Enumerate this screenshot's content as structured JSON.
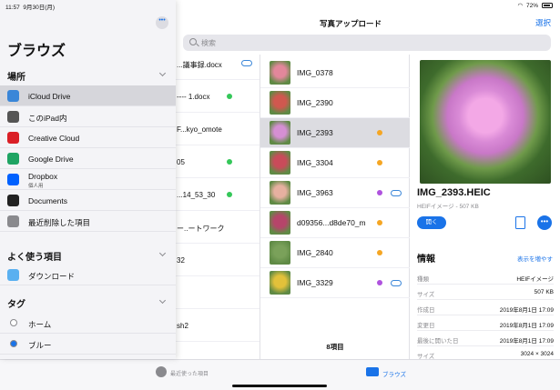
{
  "status_bar": {
    "time": "11:57",
    "date": "9月30日(月)",
    "battery": "72%"
  },
  "nav": {
    "title": "写真アップロード",
    "select": "選択"
  },
  "search": {
    "placeholder": "検索"
  },
  "column1": {
    "rows": [
      {
        "label": "...議事録.docx",
        "indicator": "cloud"
      },
      {
        "label": "---- 1.docx",
        "indicator": "green"
      },
      {
        "label": "F...kyo_omote",
        "indicator": "none"
      },
      {
        "label": "05",
        "indicator": "green"
      },
      {
        "label": "...14_53_30",
        "indicator": "green"
      },
      {
        "label": "ー..ートワーク",
        "indicator": "none"
      },
      {
        "label": "32",
        "indicator": "none"
      },
      {
        "label": "",
        "indicator": "none"
      },
      {
        "label": "sh2",
        "indicator": "none"
      }
    ]
  },
  "files": {
    "items": [
      {
        "name": "IMG_0378",
        "indicator": "none",
        "thumb_color": "#e2879b"
      },
      {
        "name": "IMG_2390",
        "indicator": "none",
        "thumb_color": "#d0584f"
      },
      {
        "name": "IMG_2393",
        "indicator": "orange",
        "thumb_color": "#d58fd3",
        "selected": true
      },
      {
        "name": "IMG_3304",
        "indicator": "orange",
        "thumb_color": "#c94b5a"
      },
      {
        "name": "IMG_3963",
        "indicator": "purple-cloud",
        "thumb_color": "#e6b0a0"
      },
      {
        "name": "d09356...d8de70_m",
        "indicator": "orange",
        "thumb_color": "#b6456a"
      },
      {
        "name": "IMG_2840",
        "indicator": "orange",
        "thumb_color": "#7aa15a"
      },
      {
        "name": "IMG_3329",
        "indicator": "purple-cloud",
        "thumb_color": "#e2c13a"
      }
    ],
    "count": "8項目"
  },
  "detail": {
    "name": "IMG_2393.HEIC",
    "subtitle": "HEIFイメージ - 507 KB",
    "open_label": "開く",
    "more_label": "•••",
    "info_title": "情報",
    "info_more": "表示を増やす",
    "info": [
      {
        "key": "種類",
        "value": "HEIFイメージ"
      },
      {
        "key": "サイズ",
        "value": "507 KB"
      },
      {
        "key": "作成日",
        "value": "2019年8月1日 17:09"
      },
      {
        "key": "変更日",
        "value": "2019年8月1日 17:09"
      },
      {
        "key": "最後に開いた日",
        "value": "2019年8月1日 17:09"
      },
      {
        "key": "サイズ",
        "value": "3024 × 3024"
      }
    ]
  },
  "sidebar": {
    "more_label": "•••",
    "title": "ブラウズ",
    "locations_header": "場所",
    "locations": [
      {
        "label": "iCloud Drive",
        "icon": "icloud-icon",
        "color": "#3a86d8",
        "active": true
      },
      {
        "label": "このiPad内",
        "icon": "ipad-icon",
        "color": "#555555"
      },
      {
        "label": "Creative Cloud",
        "icon": "creative-cloud-icon",
        "color": "#da1f26"
      },
      {
        "label": "Google Drive",
        "icon": "google-drive-icon",
        "color": "#1fa463"
      },
      {
        "label": "Dropbox",
        "sub": "個人用",
        "icon": "dropbox-icon",
        "color": "#0061ff"
      },
      {
        "label": "Documents",
        "icon": "documents-icon",
        "color": "#222222"
      },
      {
        "label": "最近削除した項目",
        "icon": "trash-icon",
        "color": "#8a8a8e"
      }
    ],
    "favorites_header": "よく使う項目",
    "favorites": [
      {
        "label": "ダウンロード",
        "icon": "folder-icon",
        "color": "#5ab0f0"
      }
    ],
    "tags_header": "タグ",
    "tags": [
      {
        "label": "ホーム",
        "color": "#ffffff"
      },
      {
        "label": "ブルー",
        "color": "#1a73e8"
      }
    ]
  },
  "tabbar": {
    "recent": "最近使った項目",
    "browse": "ブラウズ"
  }
}
